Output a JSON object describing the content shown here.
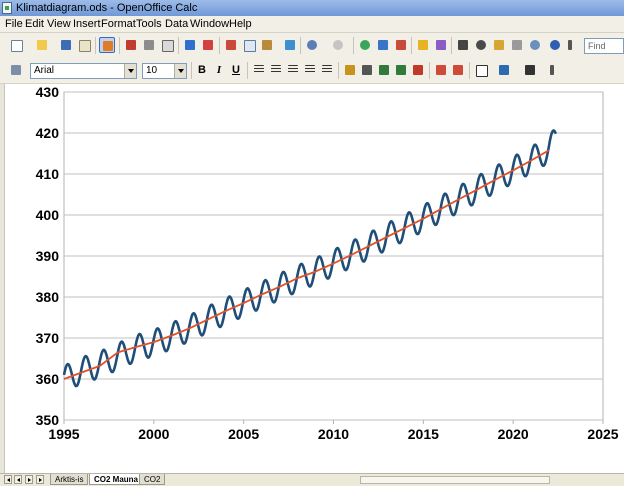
{
  "window": {
    "title": "Klimatdiagram.ods - OpenOffice Calc"
  },
  "menubar": {
    "items": [
      "File",
      "Edit",
      "View",
      "Insert",
      "Format",
      "Tools",
      "Data",
      "Window",
      "Help"
    ]
  },
  "formatting": {
    "font_name": "Arial",
    "font_size": "10",
    "bold": "B",
    "italic": "I",
    "underline": "U"
  },
  "find": {
    "placeholder": "Find"
  },
  "sheet_tabs": {
    "tabs": [
      "Arktis-is",
      "CO2 Mauna",
      "CO2"
    ],
    "active_index": 1
  },
  "colors": {
    "measured_line": "#1f4e79",
    "trend_line": "#e0522a",
    "grid": "#c0c0c0",
    "plot_border": "#b3b3b3"
  },
  "icons": [
    "new-icon",
    "open-icon",
    "save-icon",
    "email-icon",
    "edit-icon",
    "pdf-icon",
    "print-icon",
    "preview-icon",
    "spellcheck-icon",
    "autospell-icon",
    "cut-icon",
    "copy-icon",
    "paste-icon",
    "format-paintbrush-icon",
    "undo-icon",
    "redo-icon",
    "hyperlink-icon",
    "sort-ascending-icon",
    "sort-descending-icon",
    "chart-icon",
    "draw-icon",
    "find-replace-icon",
    "navigator-icon",
    "gallery-icon",
    "datasource-icon",
    "zoom-icon",
    "help-icon",
    "styles-icon"
  ],
  "chart_data": {
    "type": "line",
    "title": "",
    "xlabel": "",
    "ylabel": "",
    "xlim": [
      1995,
      2025
    ],
    "ylim": [
      350,
      430
    ],
    "xticks": [
      1995,
      2000,
      2005,
      2010,
      2015,
      2020,
      2025
    ],
    "yticks": [
      350,
      360,
      370,
      380,
      390,
      400,
      410,
      420,
      430
    ],
    "grid": true,
    "legend": "none",
    "series": [
      {
        "role": "measured",
        "seasonal_amplitude_ppm": 3.2,
        "x": [
          1995.0,
          1996.0,
          1997.0,
          1998.0,
          1999.0,
          2000.0,
          2001.0,
          2002.0,
          2003.0,
          2004.0,
          2005.0,
          2006.0,
          2007.0,
          2008.0,
          2009.0,
          2010.0,
          2011.0,
          2012.0,
          2013.0,
          2014.0,
          2015.0,
          2016.0,
          2017.0,
          2018.0,
          2019.0,
          2020.0,
          2021.0,
          2022.0,
          2022.4
        ],
        "y": [
          360.0,
          362.1,
          363.5,
          365.5,
          367.5,
          368.8,
          370.5,
          372.4,
          374.5,
          376.5,
          378.5,
          380.5,
          382.5,
          384.5,
          386.3,
          388.3,
          390.4,
          392.5,
          394.8,
          397.0,
          399.2,
          401.5,
          403.9,
          406.3,
          408.6,
          411.0,
          413.4,
          416.0,
          418.5
        ]
      },
      {
        "role": "trend",
        "x": [
          1995.0,
          1996.0,
          1997.0,
          1998.0,
          1999.0,
          2000.0,
          2001.0,
          2002.0,
          2003.0,
          2004.0,
          2005.0,
          2006.0,
          2007.0,
          2008.0,
          2009.0,
          2010.0,
          2011.0,
          2012.0,
          2013.0,
          2014.0,
          2015.0,
          2016.0,
          2017.0,
          2018.0,
          2019.0,
          2020.0,
          2021.0,
          2022.0
        ],
        "y": [
          360.0,
          361.6,
          363.2,
          366.5,
          367.8,
          369.0,
          370.6,
          372.4,
          374.5,
          376.6,
          378.5,
          380.6,
          382.5,
          384.6,
          386.2,
          388.2,
          390.3,
          392.5,
          394.7,
          396.9,
          399.1,
          401.5,
          403.9,
          406.2,
          408.6,
          410.9,
          413.3,
          415.8
        ]
      }
    ]
  }
}
